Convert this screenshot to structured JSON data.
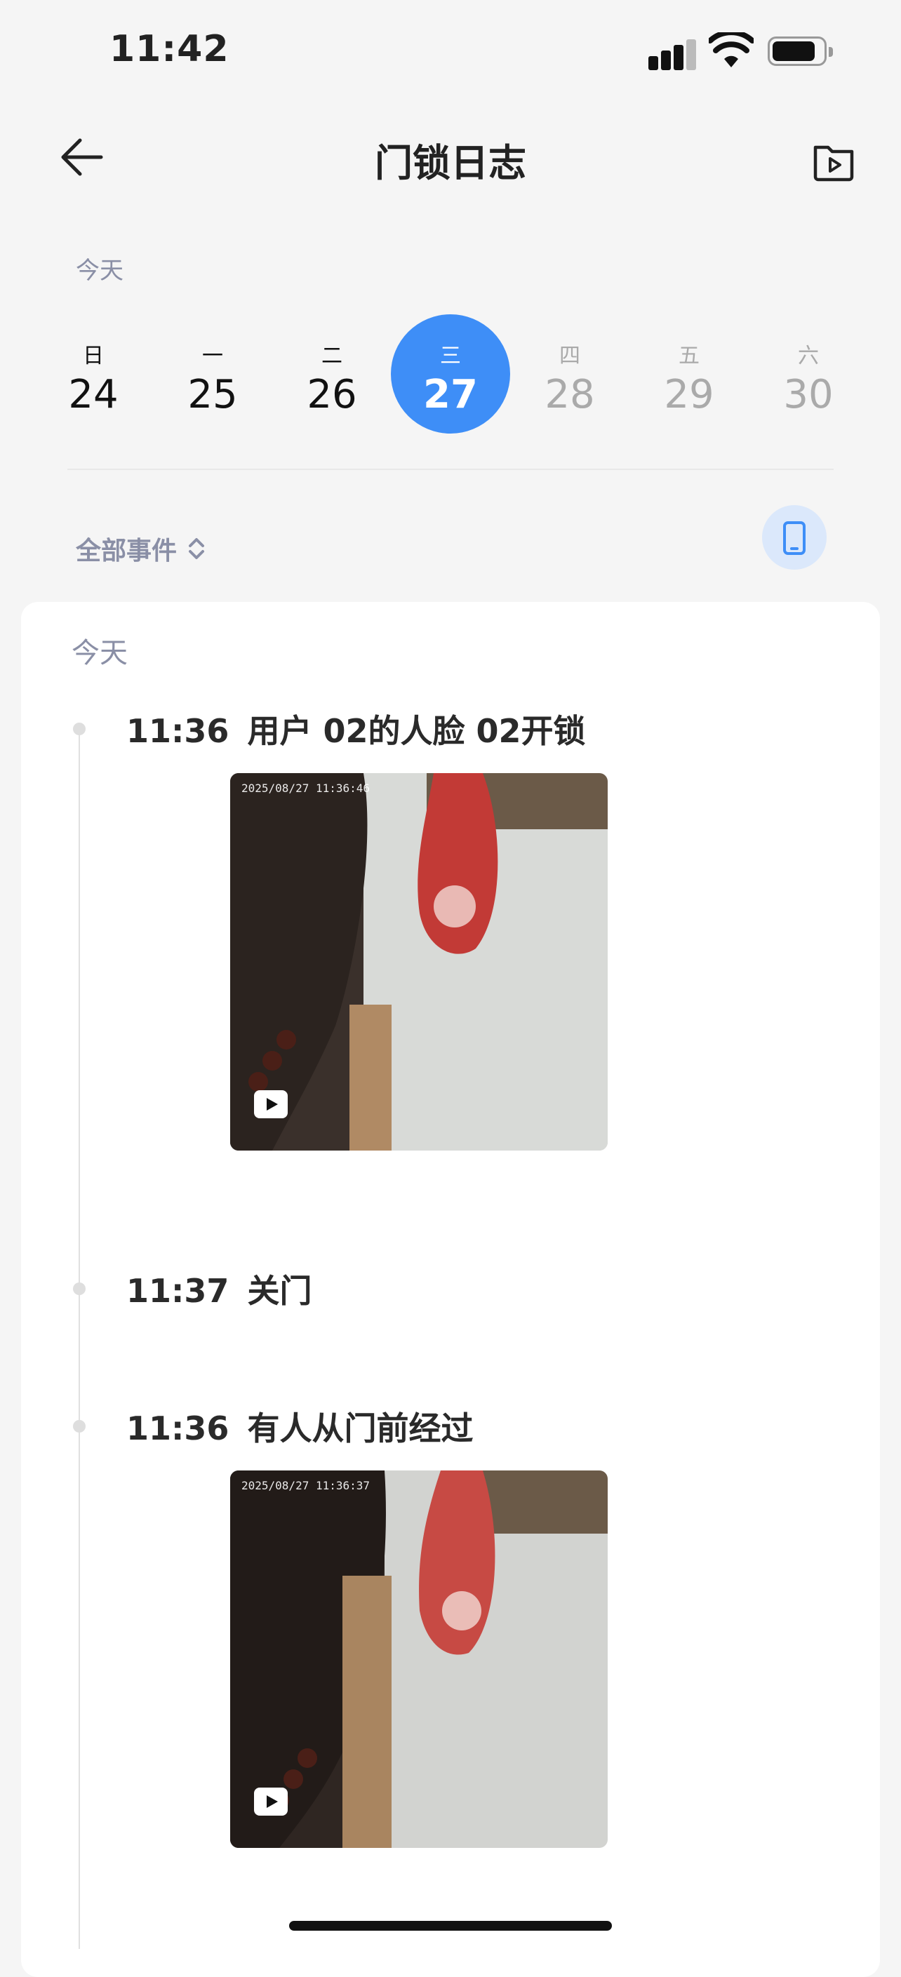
{
  "status_bar": {
    "time": "11:42"
  },
  "header": {
    "title": "门锁日志"
  },
  "date_label": "今天",
  "week": [
    {
      "weekday": "日",
      "date": "24",
      "state": "past"
    },
    {
      "weekday": "一",
      "date": "25",
      "state": "past"
    },
    {
      "weekday": "二",
      "date": "26",
      "state": "past"
    },
    {
      "weekday": "三",
      "date": "27",
      "state": "selected"
    },
    {
      "weekday": "四",
      "date": "28",
      "state": "future"
    },
    {
      "weekday": "五",
      "date": "29",
      "state": "future"
    },
    {
      "weekday": "六",
      "date": "30",
      "state": "future"
    }
  ],
  "filter": {
    "label": "全部事件"
  },
  "log": {
    "section_label": "今天",
    "events": [
      {
        "time": "11:36",
        "text": "用户 02的人脸 02开锁",
        "snapshot_timestamp": "2025/08/27  11:36:46"
      },
      {
        "time": "11:37",
        "text": "关门"
      },
      {
        "time": "11:36",
        "text": "有人从门前经过",
        "snapshot_timestamp": "2025/08/27  11:36:37"
      }
    ]
  },
  "colors": {
    "accent": "#3e8ef7",
    "muted": "#8a8fa6",
    "device_button_bg": "#dbe8fb"
  },
  "icons": {
    "back": "arrow-left-icon",
    "media": "video-folder-icon",
    "filter": "sort-updown-icon",
    "device": "phone-icon",
    "play": "play-icon"
  }
}
